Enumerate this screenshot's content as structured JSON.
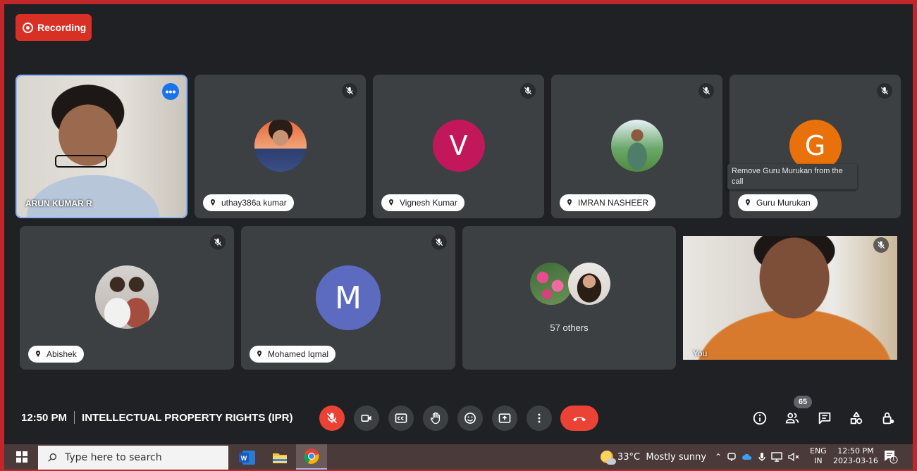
{
  "recording": {
    "label": "Recording"
  },
  "participants": [
    {
      "name": "ARUN KUMAR R"
    },
    {
      "name": "uthay386a kumar"
    },
    {
      "name": "Vignesh Kumar",
      "initial": "V",
      "color": "#c2185b"
    },
    {
      "name": "IMRAN NASHEER"
    },
    {
      "name": "Guru Murukan",
      "initial": "G",
      "color": "#e8710a"
    },
    {
      "name": "Abishek"
    },
    {
      "name": "Mohamed Iqmal",
      "initial": "M",
      "color": "#5c6bc0"
    },
    {
      "name": "You"
    }
  ],
  "tooltip": {
    "text": "Remove Guru Murukan from the call"
  },
  "others": {
    "label": "57 others"
  },
  "meeting": {
    "time": "12:50 PM",
    "title": "INTELLECTUAL PROPERTY RIGHTS (IPR)"
  },
  "controls": [
    "mic-off",
    "camera",
    "captions",
    "raise-hand",
    "emoji",
    "present",
    "more-options",
    "end-call"
  ],
  "right_controls": {
    "people_count": "65",
    "icons": [
      "info",
      "people",
      "chat",
      "activities",
      "host-controls"
    ]
  },
  "taskbar": {
    "search_placeholder": "Type here to search",
    "weather": "33°C  Mostly sunny",
    "lang_top": "ENG",
    "lang_bottom": "IN",
    "time": "12:50 PM",
    "date": "2023-03-16",
    "notification_count": "1"
  },
  "colors": {
    "recording_red": "#d93025",
    "end_call_red": "#ea4335",
    "tile_bg": "#3c4043",
    "app_bg": "#202124",
    "active_border": "#8ab4f8"
  }
}
